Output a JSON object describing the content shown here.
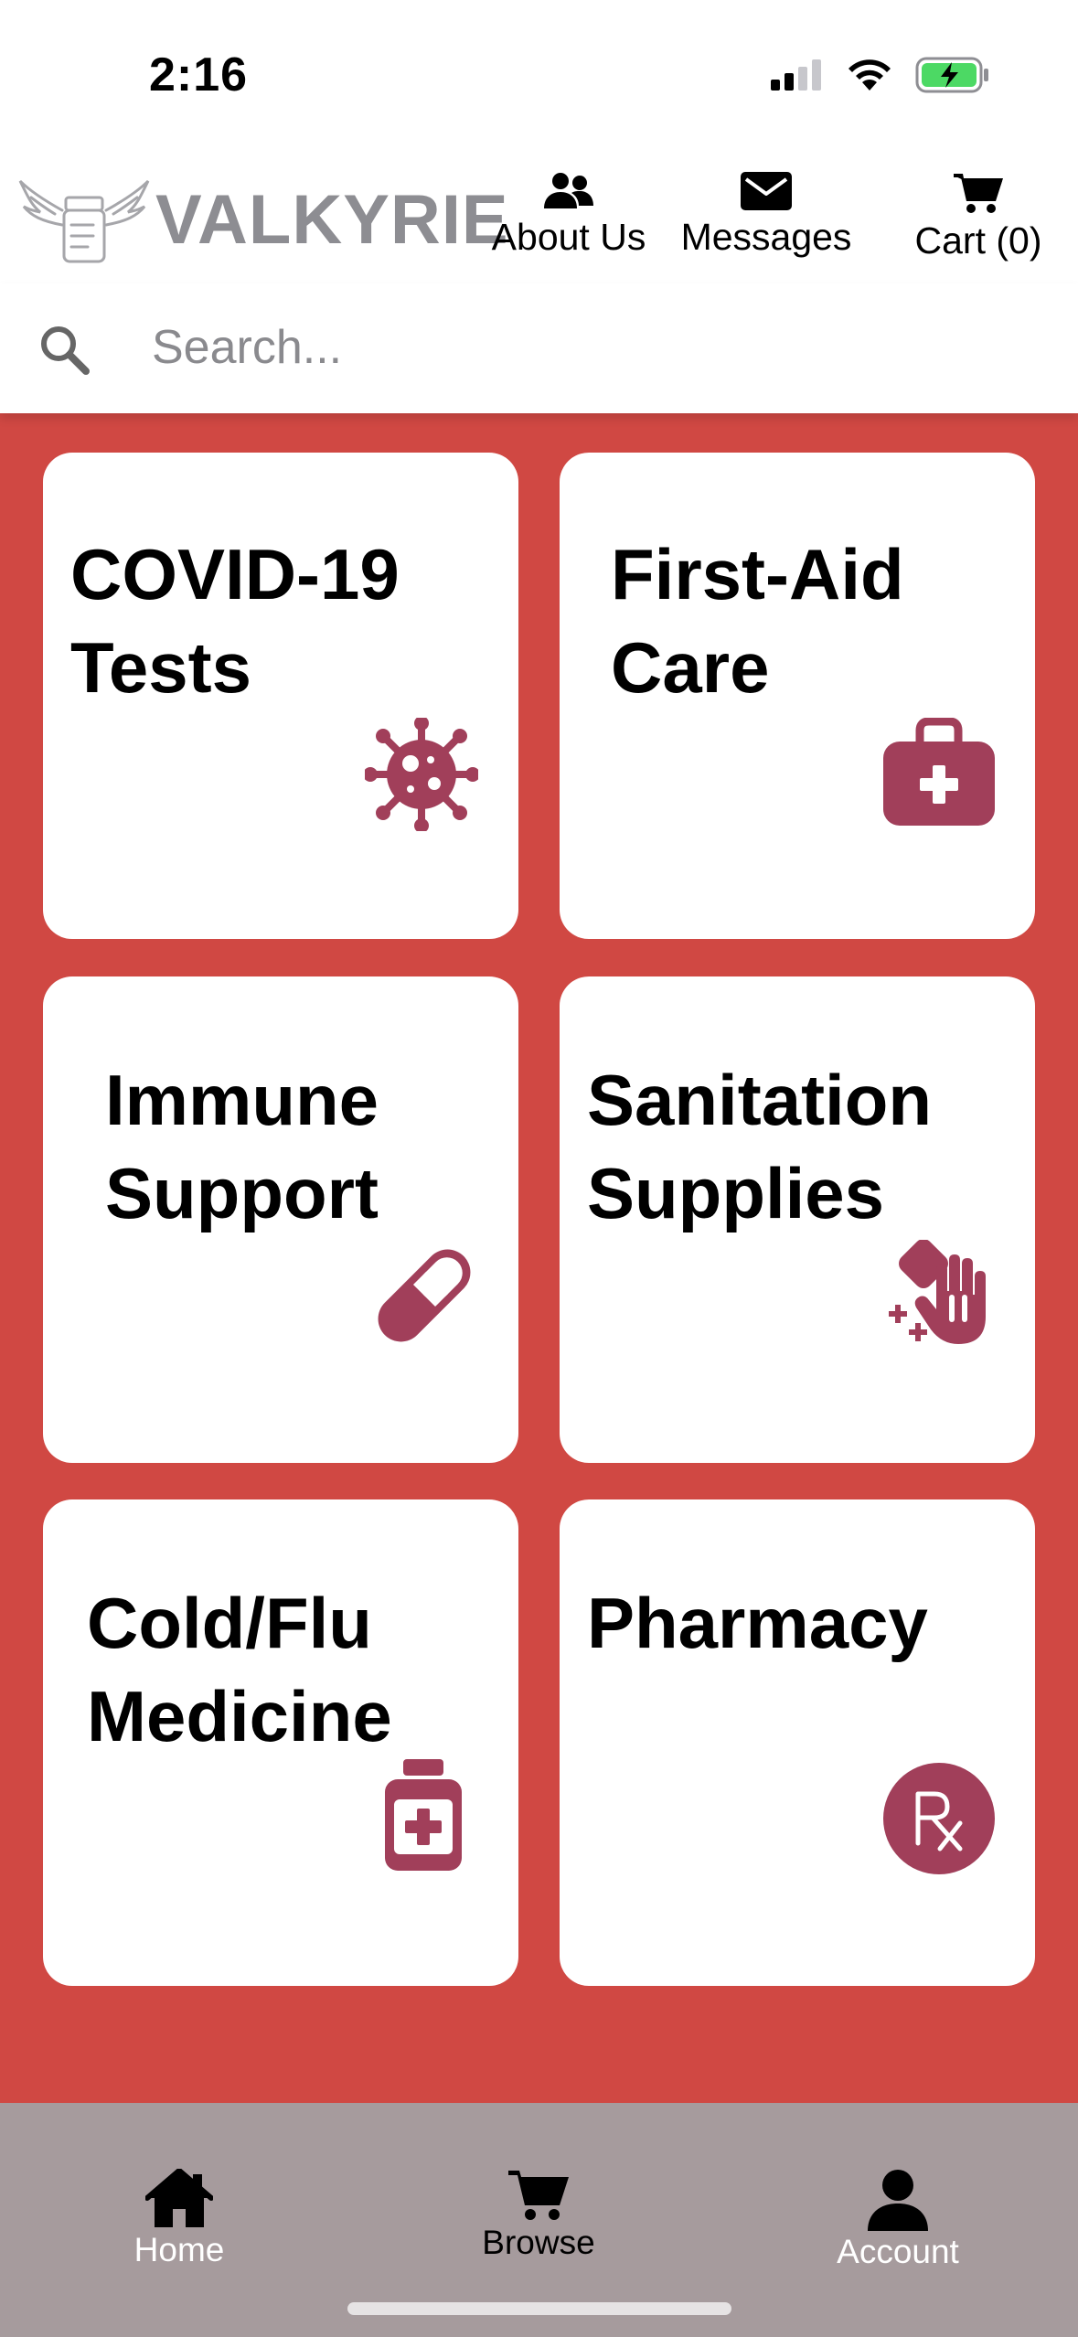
{
  "status_bar": {
    "time": "2:16"
  },
  "header": {
    "brand": "VALKYRIE",
    "nav": {
      "about_us": "About Us",
      "messages": "Messages",
      "cart": "Cart (0)"
    }
  },
  "search": {
    "placeholder": "Search...",
    "value": ""
  },
  "categories": [
    {
      "line1": "COVID-19",
      "line2": "Tests",
      "icon": "virus-icon"
    },
    {
      "line1": "First-Aid",
      "line2": "Care",
      "icon": "first-aid-kit-icon"
    },
    {
      "line1": "Immune",
      "line2": "Support",
      "icon": "pill-capsule-icon"
    },
    {
      "line1": "Sanitation",
      "line2": "Supplies",
      "icon": "hand-sparkles-icon"
    },
    {
      "line1": "Cold/Flu",
      "line2": "Medicine",
      "icon": "medicine-bottle-icon"
    },
    {
      "line1": "Pharmacy",
      "line2": "",
      "icon": "prescription-rx-icon"
    }
  ],
  "tabbar": {
    "home": "Home",
    "browse": "Browse",
    "account": "Account"
  },
  "colors": {
    "background_red": "#d04843",
    "icon_maroon": "#a13f5a",
    "brand_gray": "#8d8d92",
    "tabbar_gray": "#a69b9d"
  }
}
